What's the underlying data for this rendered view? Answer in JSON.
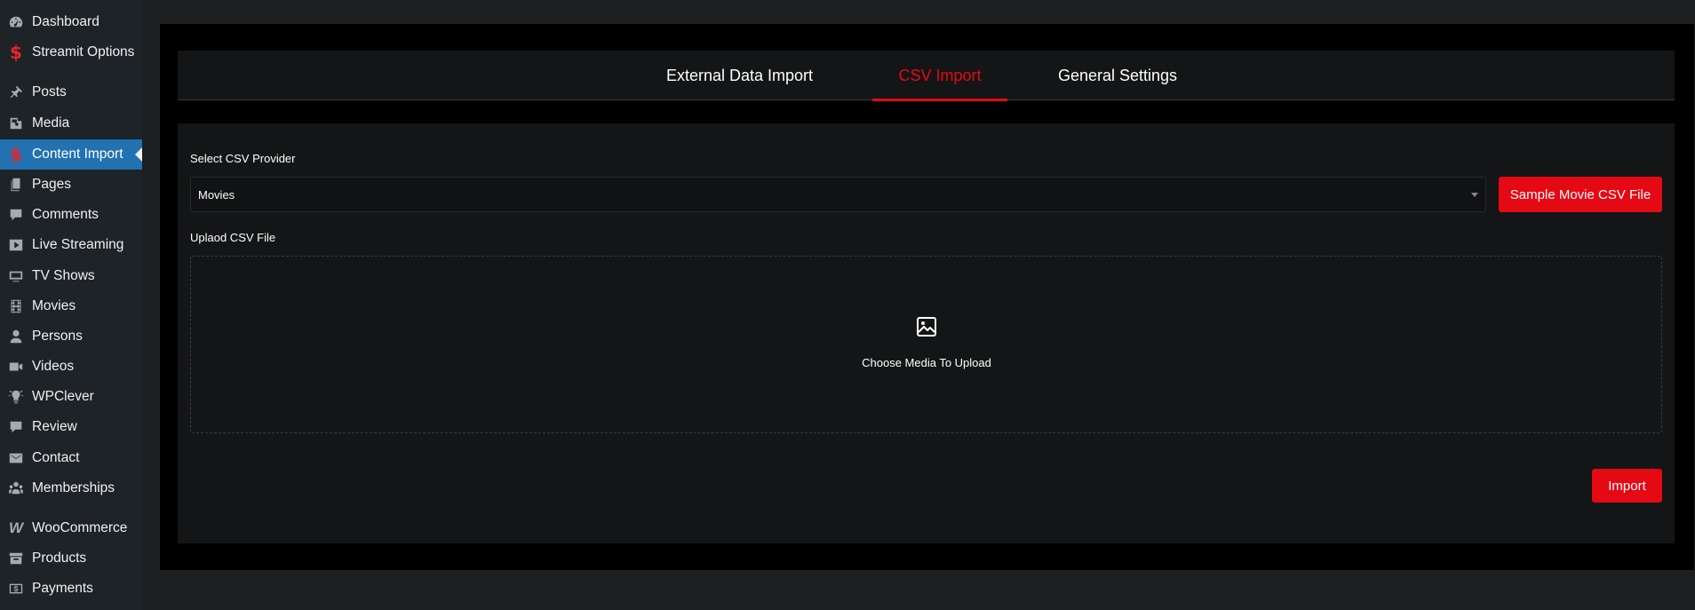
{
  "sidebar": {
    "items": [
      {
        "label": "Dashboard",
        "icon": "dashboard-icon"
      },
      {
        "label": "Streamit Options",
        "icon": "streamit-logo-icon"
      },
      {
        "label": "Posts",
        "icon": "pin-icon"
      },
      {
        "label": "Media",
        "icon": "media-icon"
      },
      {
        "label": "Content Import",
        "icon": "streamit-logo-icon",
        "active": true
      },
      {
        "label": "Pages",
        "icon": "pages-icon"
      },
      {
        "label": "Comments",
        "icon": "comment-icon"
      },
      {
        "label": "Live Streaming",
        "icon": "play-icon"
      },
      {
        "label": "TV Shows",
        "icon": "tv-icon"
      },
      {
        "label": "Movies",
        "icon": "film-icon"
      },
      {
        "label": "Persons",
        "icon": "person-icon"
      },
      {
        "label": "Videos",
        "icon": "video-camera-icon"
      },
      {
        "label": "WPClever",
        "icon": "lightbulb-icon"
      },
      {
        "label": "Review",
        "icon": "comment-icon"
      },
      {
        "label": "Contact",
        "icon": "mail-icon"
      },
      {
        "label": "Memberships",
        "icon": "groups-icon"
      },
      {
        "label": "WooCommerce",
        "icon": "woocommerce-icon"
      },
      {
        "label": "Products",
        "icon": "archive-icon"
      },
      {
        "label": "Payments",
        "icon": "dollar-icon"
      }
    ]
  },
  "tabs": [
    {
      "label": "External Data Import"
    },
    {
      "label": "CSV Import",
      "active": true
    },
    {
      "label": "General Settings"
    }
  ],
  "form": {
    "provider_label": "Select CSV Provider",
    "provider_value": "Movies",
    "sample_button": "Sample Movie CSV File",
    "upload_label": "Uplaod CSV File",
    "upload_text": "Choose Media To Upload",
    "import_button": "Import"
  },
  "colors": {
    "accent": "#e50914",
    "sidebar_bg": "#1d2327",
    "active_item_bg": "#2271b1"
  }
}
